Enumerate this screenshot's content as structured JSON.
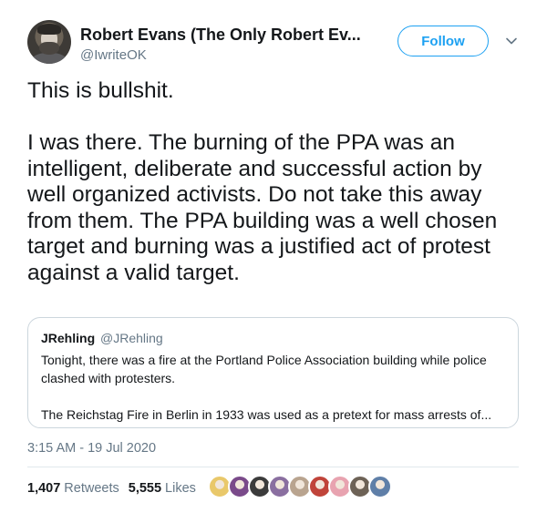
{
  "author": {
    "name": "Robert Evans (The Only Robert Ev...",
    "handle": "@IwriteOK",
    "avatar_icon": "profile-avatar"
  },
  "follow_button": {
    "label": "Follow"
  },
  "menu_icon": "chevron-down-icon",
  "tweet": {
    "text": "This is bullshit.\n\nI was there. The burning of the PPA was an intelligent, deliberate and successful action by well organized activists. Do not take this away from them. The PPA building was a well chosen target and burning was a justified act of protest against a valid target."
  },
  "quoted_tweet": {
    "author_name": "JRehling",
    "author_handle": "@JRehling",
    "text": "Tonight, there was a fire at the Portland Police Association building while police clashed with protesters.\n\nThe Reichstag Fire in Berlin in 1933 was used as a pretext for mass arrests of..."
  },
  "timestamp": "3:15 AM - 19 Jul 2020",
  "stats": {
    "retweets_count": "1,407",
    "retweets_label": "Retweets",
    "likes_count": "5,555",
    "likes_label": "Likes"
  },
  "likers": [
    {
      "color": "#e9c86a"
    },
    {
      "color": "#7a4a8a"
    },
    {
      "color": "#3b3b3b"
    },
    {
      "color": "#8a6fa0"
    },
    {
      "color": "#b9a48f"
    },
    {
      "color": "#c0443a"
    },
    {
      "color": "#e8a3b0"
    },
    {
      "color": "#6d6256"
    },
    {
      "color": "#5f7fa8"
    }
  ],
  "colors": {
    "accent": "#1da1f2",
    "text_primary": "#14171a",
    "text_secondary": "#657786",
    "border": "#ccd6dd"
  }
}
